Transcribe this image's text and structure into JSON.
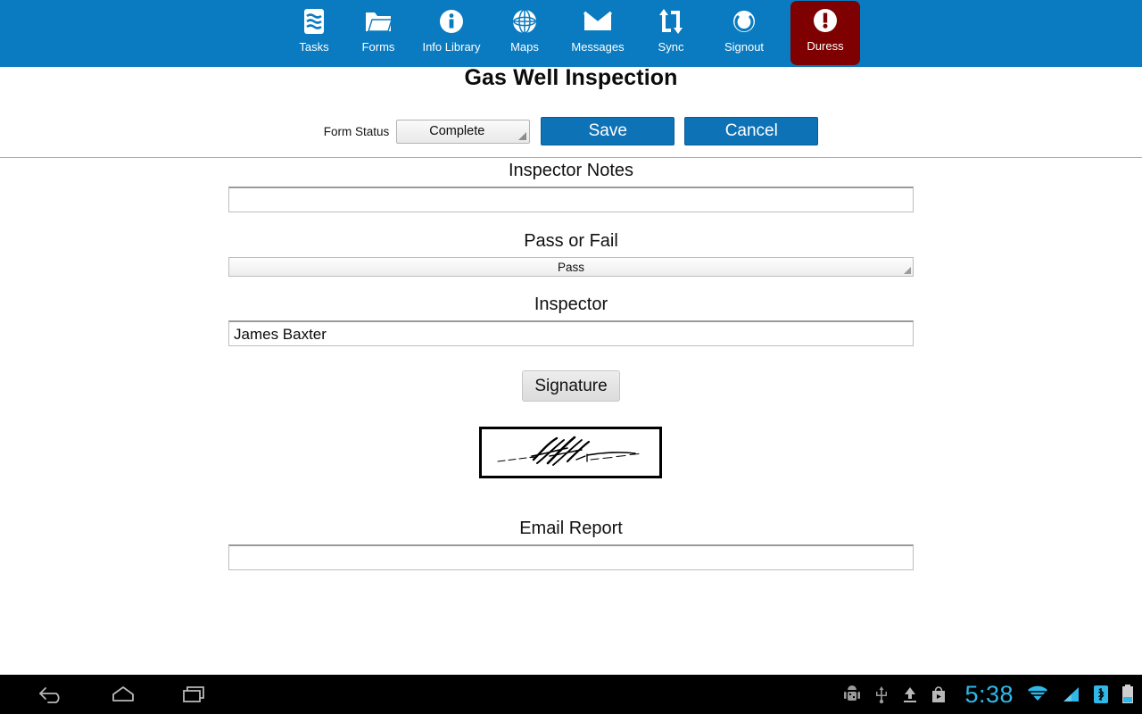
{
  "toolbar": {
    "items": [
      {
        "label": "Tasks",
        "icon": "tasks-icon"
      },
      {
        "label": "Forms",
        "icon": "folder-icon"
      },
      {
        "label": "Info Library",
        "icon": "info-circle-icon"
      },
      {
        "label": "Maps",
        "icon": "globe-icon"
      },
      {
        "label": "Messages",
        "icon": "envelope-icon"
      },
      {
        "label": "Sync",
        "icon": "sync-arrows-icon"
      },
      {
        "label": "Signout",
        "icon": "power-icon"
      },
      {
        "label": "Duress",
        "icon": "exclamation-circle-icon"
      }
    ],
    "background_color": "#0a7bc0",
    "duress_color": "#7e0000"
  },
  "page": {
    "title": "Gas Well Inspection"
  },
  "status_row": {
    "label": "Form Status",
    "form_status_value": "Complete",
    "save_label": "Save",
    "cancel_label": "Cancel",
    "button_color": "#0e72b7"
  },
  "fields": {
    "inspector_notes": {
      "title": "Inspector Notes",
      "value": "",
      "placeholder": ""
    },
    "pass_or_fail": {
      "title": "Pass or Fail",
      "value": "Pass"
    },
    "inspector": {
      "title": "Inspector",
      "value": "James Baxter",
      "placeholder": ""
    },
    "signature": {
      "button_label": "Signature"
    },
    "email_report": {
      "title": "Email Report",
      "value": "",
      "placeholder": ""
    }
  },
  "system_bar": {
    "clock": "5:38",
    "nav_keys": [
      {
        "name": "back-icon"
      },
      {
        "name": "home-icon"
      },
      {
        "name": "recent-apps-icon"
      }
    ],
    "status_icons": [
      {
        "name": "android-debug-icon"
      },
      {
        "name": "usb-icon"
      },
      {
        "name": "upload-icon"
      },
      {
        "name": "play-store-icon"
      },
      {
        "name": "wifi-icon"
      },
      {
        "name": "cell-signal-icon"
      },
      {
        "name": "bluetooth-icon"
      },
      {
        "name": "battery-icon"
      }
    ],
    "accent_color": "#2fb8e8"
  }
}
